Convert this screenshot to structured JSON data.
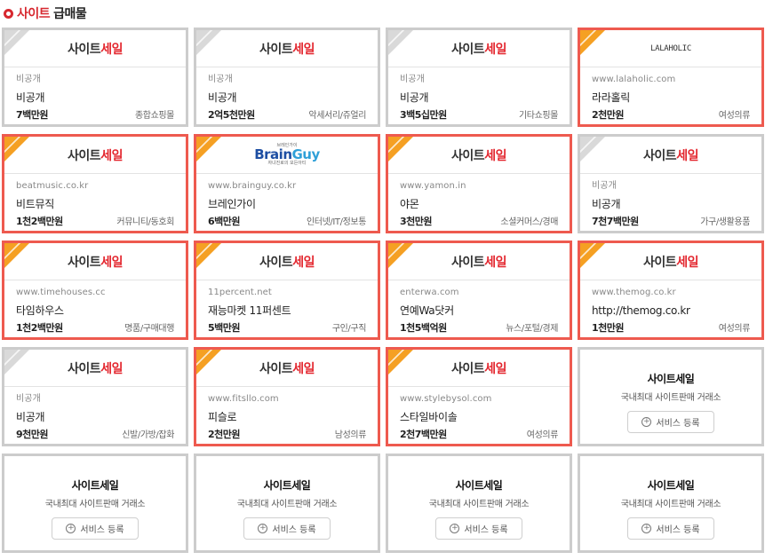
{
  "section": {
    "title_red": "사이트",
    "title_dark": "급매물"
  },
  "logo_default": {
    "part1": "사이트",
    "part2": "세일"
  },
  "brainguy_logo": {
    "top": "브레인가이",
    "brain": "Brain",
    "guy": "Guy",
    "bottom": "자녀진로의 모든아티"
  },
  "colors": {
    "hot_border": "#ee5a4f",
    "default_border": "#cccccc",
    "accent_red": "#e3262e",
    "hot_corner": "#f5a023"
  },
  "listings": [
    {
      "logo": "default",
      "hot": false,
      "url": "비공개",
      "name": "비공개",
      "price": "7백만원",
      "category": "종합쇼핑몰"
    },
    {
      "logo": "default",
      "hot": false,
      "url": "비공개",
      "name": "비공개",
      "price": "2억5천만원",
      "category": "악세서리/쥬얼리"
    },
    {
      "logo": "default",
      "hot": false,
      "url": "비공개",
      "name": "비공개",
      "price": "3백5십만원",
      "category": "기타쇼핑몰"
    },
    {
      "logo": "LALAHOLIC",
      "hot": true,
      "url": "www.lalaholic.com",
      "name": "라라홀릭",
      "price": "2천만원",
      "category": "여성의류"
    },
    {
      "logo": "default",
      "hot": true,
      "url": "beatmusic.co.kr",
      "name": "비트뮤직",
      "price": "1천2백만원",
      "category": "커뮤니티/동호회"
    },
    {
      "logo": "brainguy",
      "hot": true,
      "url": "www.brainguy.co.kr",
      "name": "브레인가이",
      "price": "6백만원",
      "category": "인터넷/IT/정보통"
    },
    {
      "logo": "default",
      "hot": true,
      "url": "www.yamon.in",
      "name": "야몬",
      "price": "3천만원",
      "category": "소셜커머스/경매"
    },
    {
      "logo": "default",
      "hot": false,
      "url": "비공개",
      "name": "비공개",
      "price": "7천7백만원",
      "category": "가구/생활용품"
    },
    {
      "logo": "default",
      "hot": true,
      "url": "www.timehouses.cc",
      "name": "타임하우스",
      "price": "1천2백만원",
      "category": "명품/구매대행"
    },
    {
      "logo": "default",
      "hot": true,
      "url": "11percent.net",
      "name": "재능마켓 11퍼센트",
      "price": "5백만원",
      "category": "구인/구직"
    },
    {
      "logo": "default",
      "hot": true,
      "url": "enterwa.com",
      "name": "연예Wa닷커",
      "price": "1천5백억원",
      "category": "뉴스/포털/경제"
    },
    {
      "logo": "default",
      "hot": true,
      "url": "www.themog.co.kr",
      "name": "http://themog.co.kr",
      "price": "1천만원",
      "category": "여성의류"
    },
    {
      "logo": "default",
      "hot": false,
      "url": "비공개",
      "name": "비공개",
      "price": "9천만원",
      "category": "신발/가방/잡화"
    },
    {
      "logo": "default",
      "hot": true,
      "url": "www.fitsllo.com",
      "name": "피슬로",
      "price": "2천만원",
      "category": "남성의류"
    },
    {
      "logo": "default",
      "hot": true,
      "url": "www.stylebysol.com",
      "name": "스타일바이솔",
      "price": "2천7백만원",
      "category": "여성의류"
    }
  ],
  "promo": {
    "title": "사이트세일",
    "subtitle": "국내최대 사이트판매 거래소",
    "button_label": "서비스 등록",
    "button_icon": "plus-circle-icon",
    "count": 5
  }
}
